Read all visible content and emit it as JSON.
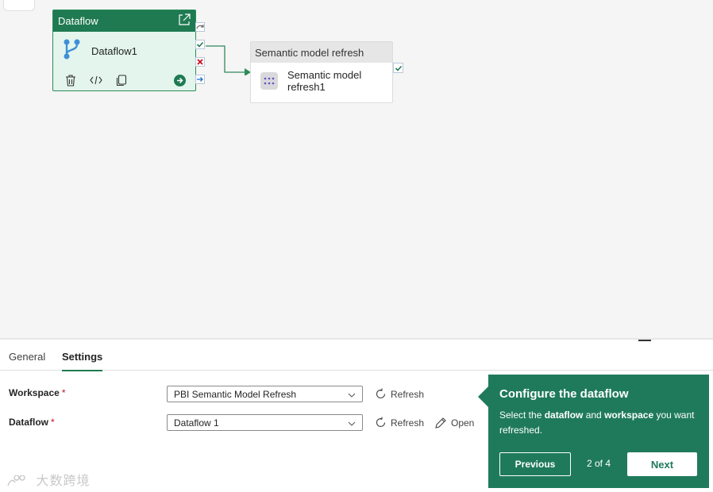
{
  "canvas": {
    "dataflow_card": {
      "header": "Dataflow",
      "name": "Dataflow1"
    },
    "semantic_card": {
      "header": "Semantic model refresh",
      "name_line1": "Semantic model",
      "name_line2": "refresh1"
    }
  },
  "tabs": [
    {
      "label": "General"
    },
    {
      "label": "Settings"
    }
  ],
  "settings": {
    "workspace": {
      "label": "Workspace",
      "required": "*",
      "value": "PBI Semantic Model Refresh",
      "refresh": "Refresh"
    },
    "dataflow": {
      "label": "Dataflow",
      "required": "*",
      "value": "Dataflow 1",
      "refresh": "Refresh",
      "open": "Open"
    }
  },
  "bubble": {
    "title": "Configure the dataflow",
    "text_1": "Select the ",
    "text_bold_1": "dataflow",
    "text_2": " and ",
    "text_bold_2": "workspace",
    "text_3": " you want refreshed.",
    "previous": "Previous",
    "counter": "2 of 4",
    "next": "Next"
  },
  "watermark": "大数跨境",
  "colors": {
    "accent": "#1f7a52",
    "bubble": "#1f7a5c",
    "required": "#c50f1f"
  }
}
